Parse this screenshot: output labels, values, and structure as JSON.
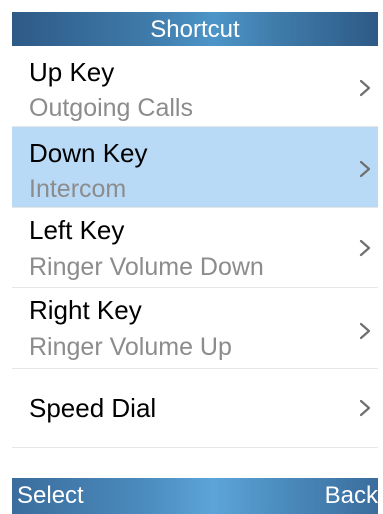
{
  "header": {
    "title": "Shortcut"
  },
  "menu": {
    "items": [
      {
        "title": "Up Key",
        "value": "Outgoing Calls",
        "chevron": ">"
      },
      {
        "title": "Down Key",
        "value": "Intercom",
        "chevron": ">"
      },
      {
        "title": "Left Key",
        "value": "Ringer Volume Down",
        "chevron": ">"
      },
      {
        "title": "Right Key",
        "value": "Ringer Volume Up",
        "chevron": ">"
      },
      {
        "title": "Speed Dial",
        "value": "",
        "chevron": ">"
      }
    ],
    "selected_index": 1
  },
  "softkeys": {
    "left": "Select",
    "right": "Back"
  },
  "colors": {
    "header_bar": "#3f7cab",
    "selected_row": "#b8daf7",
    "softkey_bar": "#4b8bbd",
    "secondary_text": "#8c8c8c"
  },
  "icons": {
    "row_indicator": "chevron-right-icon"
  }
}
